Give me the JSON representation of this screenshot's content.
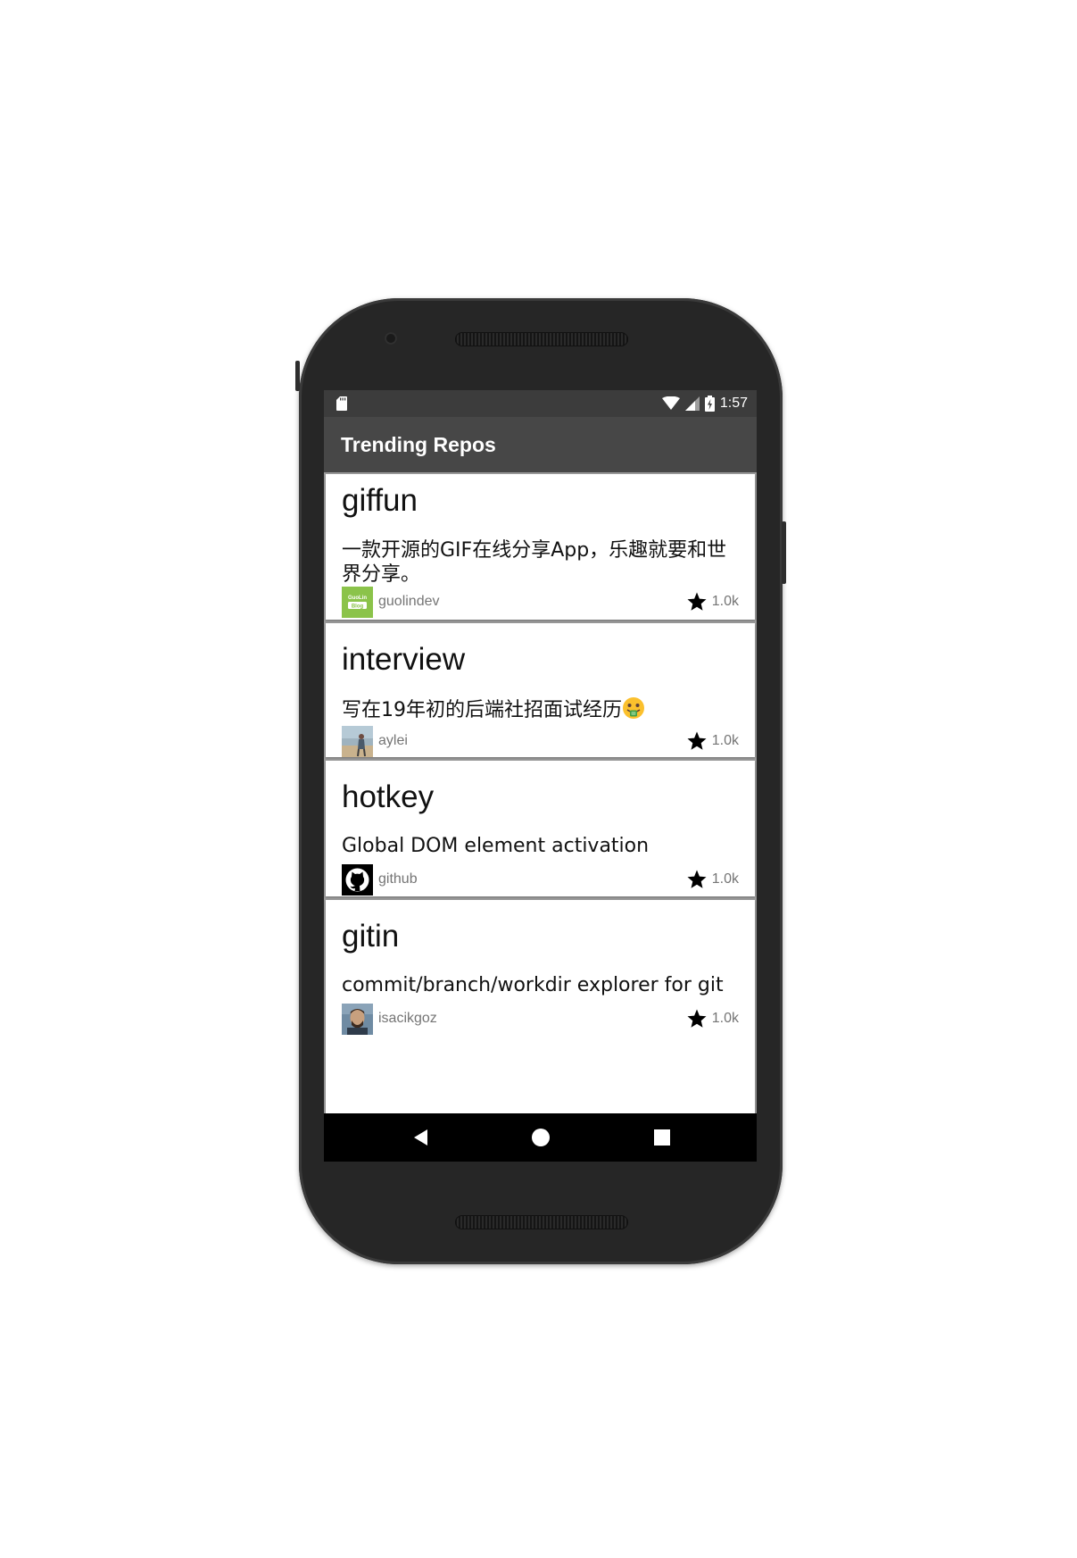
{
  "app": {
    "title": "Trending Repos"
  },
  "status_bar": {
    "time": "1:57",
    "icons": [
      "sd-card-icon",
      "wifi-icon",
      "signal-icon",
      "battery-charging-icon"
    ]
  },
  "repos": [
    {
      "name": "giffun",
      "description": "一款开源的GIF在线分享App，乐趣就要和世界分享。",
      "owner": "guolindev",
      "stars": "1.0k",
      "avatar_icon": "guolin-blog-avatar"
    },
    {
      "name": "interview",
      "description": "写在19年初的后端社招面试经历",
      "emoji": "money-mouth-face-emoji",
      "owner": "aylei",
      "stars": "1.0k",
      "avatar_icon": "aylei-photo-avatar"
    },
    {
      "name": "hotkey",
      "description": "Global DOM element activation",
      "owner": "github",
      "stars": "1.0k",
      "avatar_icon": "github-octocat-avatar"
    },
    {
      "name": "gitin",
      "description": "commit/branch/workdir explorer for git",
      "owner": "isacikgoz",
      "stars": "1.0k",
      "avatar_icon": "isacikgoz-photo-avatar"
    }
  ],
  "avatar_badge": {
    "line1": "GuoLin",
    "line2": "Blog"
  },
  "nav_bar": {
    "buttons": [
      "back-icon",
      "home-icon",
      "recents-icon"
    ]
  },
  "colors": {
    "status_bar": "#3c3c3c",
    "toolbar": "#474747",
    "card": "#ffffff",
    "divider": "#9a9a9a",
    "secondary_text": "#757575",
    "phone_body": "#262626",
    "guolin_avatar": "#8bc34a"
  }
}
